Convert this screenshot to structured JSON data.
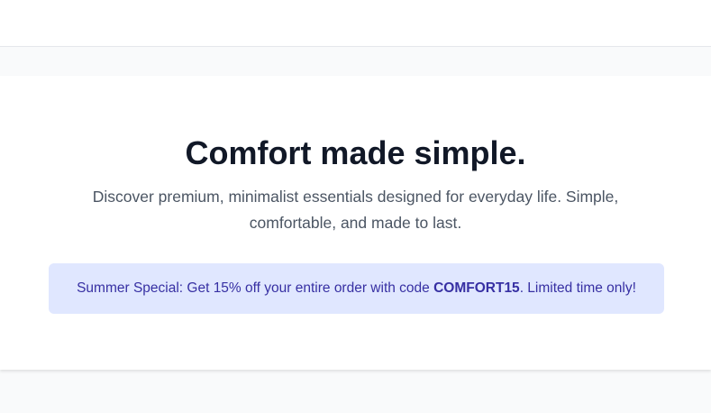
{
  "hero": {
    "title": "Comfort made simple.",
    "subtitle": "Discover premium, minimalist essentials designed for everyday life. Simple, comfortable, and made to last."
  },
  "promo": {
    "prefix": "Summer Special: Get 15% off your entire order with code ",
    "code": "COMFORT15",
    "suffix": ". Limited time only!"
  },
  "colors": {
    "page_background": "#f9fafb",
    "title": "#111827",
    "subtitle": "#4b5563",
    "promo_background": "#e0e7ff",
    "promo_text": "#3730a3"
  }
}
